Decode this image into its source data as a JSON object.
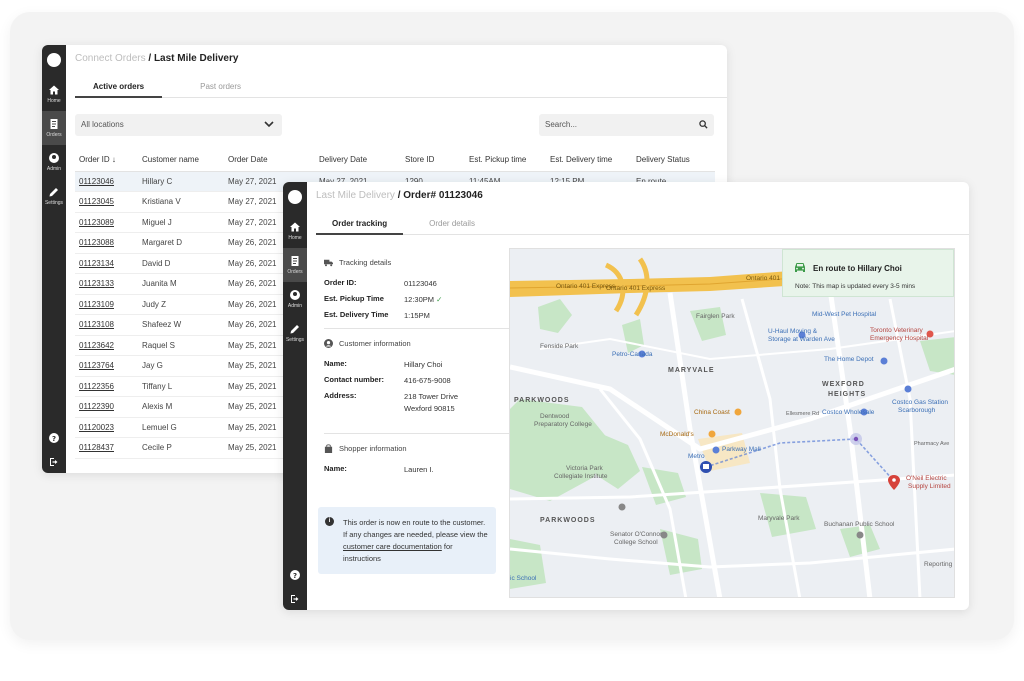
{
  "orders_window": {
    "breadcrumb": {
      "parent": "Connect Orders",
      "sep": " / ",
      "current": "Last Mile Delivery"
    },
    "rail": {
      "items": [
        {
          "label": "Home"
        },
        {
          "label": "Orders"
        },
        {
          "label": "Admin"
        },
        {
          "label": "Settings"
        }
      ]
    },
    "tabs": [
      {
        "label": "Active orders"
      },
      {
        "label": "Past orders"
      }
    ],
    "location_select": {
      "value": "All locations"
    },
    "search": {
      "placeholder": "Search..."
    },
    "columns": [
      "Order ID",
      "Customer name",
      "Order Date",
      "Delivery Date",
      "Store ID",
      "Est. Pickup time",
      "Est. Delivery time",
      "Delivery Status"
    ],
    "rows": [
      {
        "id": "01123046",
        "name": "Hillary C",
        "date": "May 27, 2021",
        "delivery": "May 27, 2021",
        "store": "1290",
        "pickup": "11:45AM",
        "est_delivery": "12:15 PM",
        "status": "En route"
      },
      {
        "id": "01123045",
        "name": "Kristiana V",
        "date": "May 27, 2021"
      },
      {
        "id": "01123089",
        "name": "Miguel J",
        "date": "May 27, 2021"
      },
      {
        "id": "01123088",
        "name": "Margaret D",
        "date": "May 26, 2021"
      },
      {
        "id": "01123134",
        "name": "David D",
        "date": "May 26, 2021"
      },
      {
        "id": "01123133",
        "name": "Juanita M",
        "date": "May 26, 2021"
      },
      {
        "id": "01123109",
        "name": "Judy Z",
        "date": "May 26, 2021"
      },
      {
        "id": "01123108",
        "name": "Shafeez W",
        "date": "May 26, 2021"
      },
      {
        "id": "01123642",
        "name": "Raquel S",
        "date": "May 25, 2021"
      },
      {
        "id": "01123764",
        "name": "Jay G",
        "date": "May 25, 2021"
      },
      {
        "id": "01122356",
        "name": "Tiffany L",
        "date": "May 25, 2021"
      },
      {
        "id": "01122390",
        "name": "Alexis M",
        "date": "May 25, 2021"
      },
      {
        "id": "01120023",
        "name": "Lemuel G",
        "date": "May 25, 2021"
      },
      {
        "id": "01128437",
        "name": "Cecile P",
        "date": "May 25, 2021"
      }
    ]
  },
  "detail_window": {
    "breadcrumb": {
      "parent": "Last Mile Delivery",
      "sep": " / ",
      "current": "Order# 01123046"
    },
    "rail": {
      "items": [
        {
          "label": "Home"
        },
        {
          "label": "Orders"
        },
        {
          "label": "Admin"
        },
        {
          "label": "Settings"
        }
      ]
    },
    "tabs": [
      {
        "label": "Order tracking"
      },
      {
        "label": "Order details"
      }
    ],
    "tracking": {
      "title": "Tracking details",
      "order_id_label": "Order ID:",
      "order_id": "01123046",
      "pickup_label": "Est. Pickup Time",
      "pickup": "12:30PM",
      "delivery_label": "Est. Delivery Time",
      "delivery": "1:15PM"
    },
    "customer": {
      "title": "Customer information",
      "name_label": "Name:",
      "name": "Hillary Choi",
      "contact_label": "Contact number:",
      "contact": "416-675-9008",
      "address_label": "Address:",
      "address_line1": "218 Tower Drive",
      "address_line2": "Wexford 90815"
    },
    "shopper": {
      "title": "Shopper information",
      "name_label": "Name:",
      "name": "Lauren I."
    },
    "notice": {
      "text_before": "This order is now en route to the customer. If any changes are needed, please view the ",
      "link": "customer care documentation",
      "text_after": " for instructions"
    },
    "route_card": {
      "title": "En route to Hillary Choi",
      "subtitle": "Note: This map is updated every 3-5 mins"
    },
    "map_labels": {
      "hwy1": "Ontario 401 Express",
      "hwy2": "Ontario 401 Express",
      "hwy3": "Ontario 401 Express",
      "fenside": "Fenside Park",
      "petro": "Petro-Canada",
      "fairglen": "Fairglen Park",
      "maryvale": "MARYVALE",
      "parkwoods1": "PARKWOODS",
      "parkwoods2": "PARKWOODS",
      "wexford": "WEXFORD",
      "heights": "HEIGHTS",
      "uhaul": "U-Haul Moving &",
      "uhaul2": "Storage at Warden Ave",
      "midwest": "Mid-West Pet Hospital",
      "toronto_vet": "Toronto Veterinary",
      "toronto_vet2": "Emergency Hospital",
      "home_depot": "The Home Depot",
      "costco_gas": "Costco Gas Station",
      "costco_gas2": "Scarborough",
      "costco": "Costco Wholesale",
      "china": "China Coast",
      "mcd": "McDonald's",
      "parkway": "Parkway Mall",
      "metro": "Metro",
      "dentwood": "Dentwood",
      "dentwood2": "Preparatory College",
      "victoria": "Victoria Park",
      "victoria2": "Collegiate Institute",
      "maryvale_park": "Maryvale Park",
      "oneil": "O'Neil Electric",
      "oneil2": "Supply Limited",
      "buchanan": "Buchanan Public School",
      "senator": "Senator O'Connor",
      "senator2": "College School",
      "school": "ic School",
      "reporting": "Reporting",
      "ellesmere": "Ellesmere Rd",
      "pharmacy": "Pharmacy Ave"
    }
  },
  "colors": {
    "rail": "#2a2a2a",
    "highlight_row": "#eef3f8",
    "notice_bg": "#e8f0f9",
    "route_card_bg": "#e8f4ea",
    "route_icon": "#3d9b49",
    "highway": "#f2c14e",
    "park": "#c7e6c6"
  }
}
